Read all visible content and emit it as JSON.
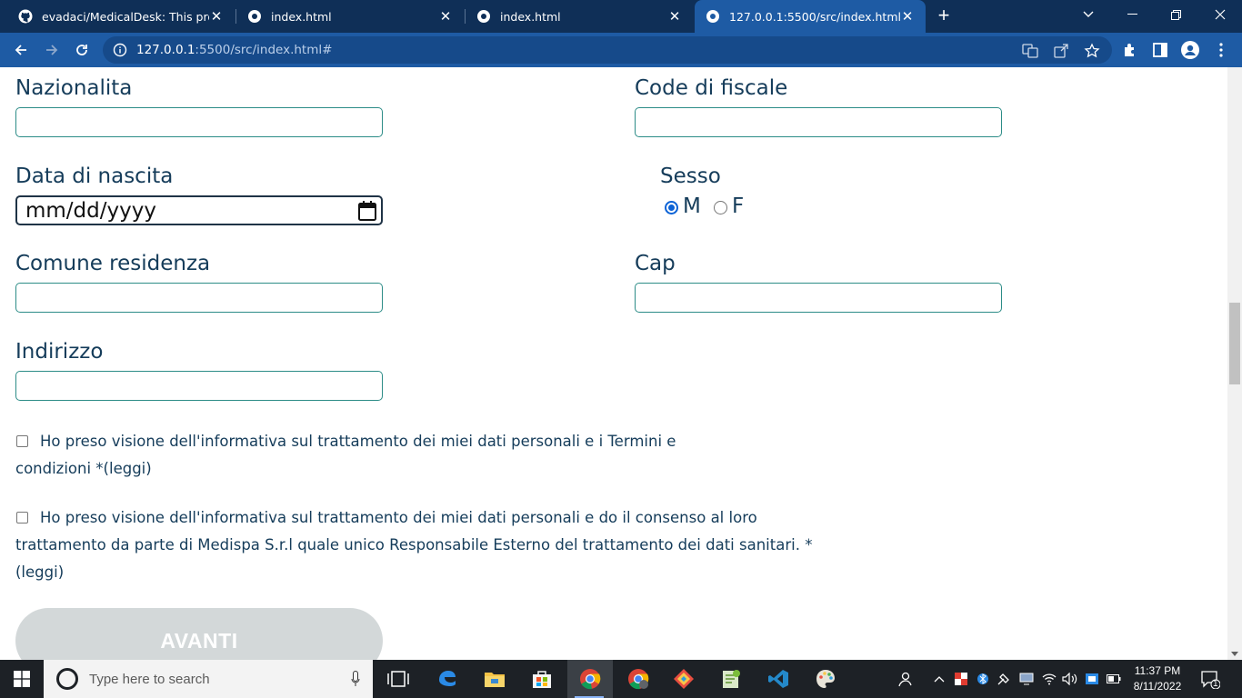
{
  "browser": {
    "tabs": [
      {
        "title": "evadaci/MedicalDesk: This project",
        "icon": "github-icon"
      },
      {
        "title": "index.html",
        "icon": "globe-icon"
      },
      {
        "title": "index.html",
        "icon": "globe-icon"
      },
      {
        "title": "127.0.0.1:5500/src/index.html#",
        "icon": "globe-icon",
        "active": true
      }
    ],
    "url_host": "127.0.0.1",
    "url_path": ":5500/src/index.html#"
  },
  "form": {
    "nazionalita_label": "Nazionalita",
    "codice_fiscale_label": "Code di fiscale",
    "data_nascita_label": "Data di nascita",
    "data_nascita_value": "mm/dd/yyyy",
    "sesso_label": "Sesso",
    "sesso_options": [
      "M",
      "F"
    ],
    "sesso_selected": "M",
    "comune_label": "Comune residenza",
    "cap_label": "Cap",
    "indirizzo_label": "Indirizzo",
    "consent1_line1": "Ho preso visione dell'informativa sul trattamento dei miei dati personali e i Termini e",
    "consent1_line2": "condizioni *(leggi)",
    "consent2_line1": "Ho preso visione dell'informativa sul trattamento dei miei dati personali e do il consenso al loro",
    "consent2_line2": "trattamento da parte di Medispa S.r.l quale unico Responsabile Esterno del trattamento dei dati sanitari. *",
    "consent2_line3": "(leggi)",
    "submit_label": "AVANTI"
  },
  "taskbar": {
    "search_placeholder": "Type here to search",
    "time": "11:37 PM",
    "date": "8/11/2022",
    "notification_count": "1"
  },
  "colors": {
    "chrome_tabbar": "#0f2f57",
    "chrome_toolbar": "#1e5ba4",
    "input_border": "#2c8c87",
    "label_text": "#153c5a",
    "radio_accent": "#0b62d6",
    "button_disabled": "#d3d8d9"
  }
}
